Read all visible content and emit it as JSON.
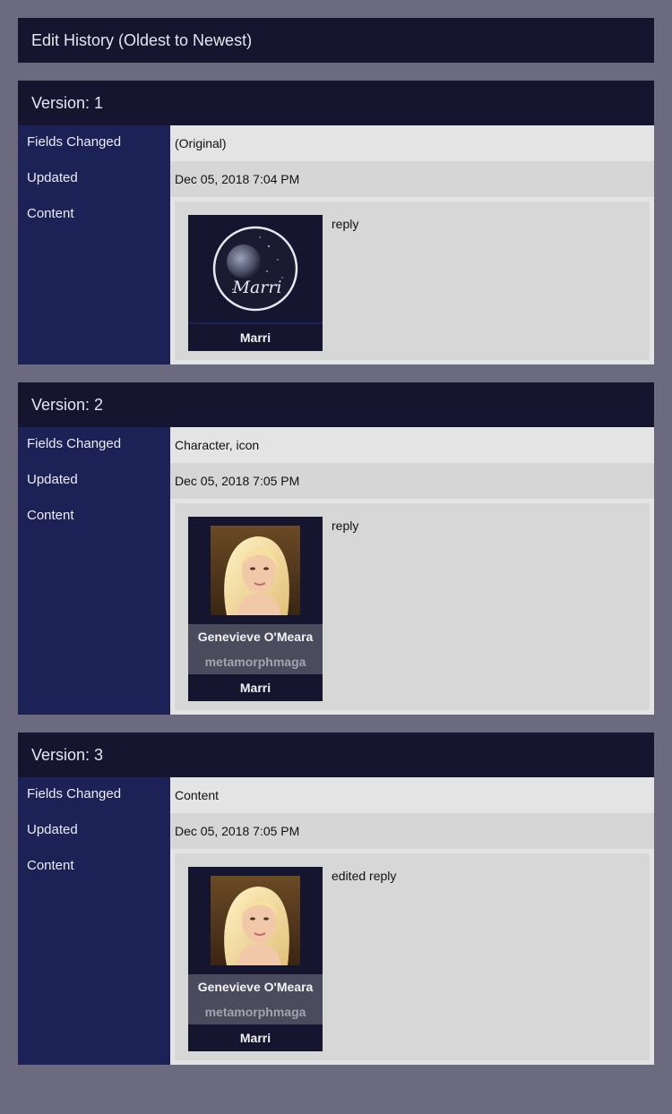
{
  "page_title": "Edit History (Oldest to Newest)",
  "labels": {
    "fields_changed": "Fields Changed",
    "updated": "Updated",
    "content": "Content"
  },
  "versions": [
    {
      "header": "Version: 1",
      "fields_changed": "(Original)",
      "updated": "Dec 05, 2018 7:04 PM",
      "icon": "moon-icon",
      "icon_text": "Marri",
      "user": "Marri",
      "text": "reply"
    },
    {
      "header": "Version: 2",
      "fields_changed": "Character, icon",
      "updated": "Dec 05, 2018 7:05 PM",
      "icon": "portrait-icon",
      "character": "Genevieve O'Meara",
      "screenname": "metamorphmaga",
      "user": "Marri",
      "text": "reply"
    },
    {
      "header": "Version: 3",
      "fields_changed": "Content",
      "updated": "Dec 05, 2018 7:05 PM",
      "icon": "portrait-icon",
      "character": "Genevieve O'Meara",
      "screenname": "metamorphmaga",
      "user": "Marri",
      "text": "edited reply"
    }
  ],
  "colors": {
    "background": "#6b6a7f",
    "header": "#15152f",
    "label_column": "#1c2255",
    "row_light": "#e4e4e4",
    "row_dark": "#d6d6d6"
  }
}
